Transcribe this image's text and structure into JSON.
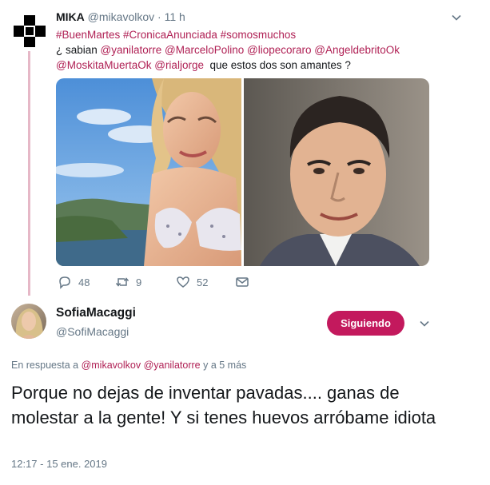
{
  "tweet": {
    "author_name": "MIKA",
    "author_handle": "@mikavolkov",
    "separator": "·",
    "time": "11 h",
    "line1": "#BuenMartes #CronicaAnunciada #somosmuchos",
    "line2_prefix": "¿ sabian",
    "line2_mentions": "@yanilatorre @MarceloPolino @liopecoraro @AngeldebritoOk",
    "line3_mentions": "@MoskitaMuertaOk @rialjorge",
    "line3_suffix": "que estos dos son amantes ?",
    "replies": "48",
    "retweets": "9",
    "likes": "52"
  },
  "reply": {
    "author_name": "SofiaMacaggi",
    "author_handle": "@SofiMacaggi",
    "follow_label": "Siguiendo",
    "replying_prefix": "En respuesta a",
    "replying_mentions": "@mikavolkov @yanilatorre",
    "replying_suffix": "y a 5 más",
    "text": "Porque no dejas de inventar pavadas.... ganas de molestar a la gente! Y si tenes huevos arróbame idiota",
    "timestamp": "12:17 - 15 ene. 2019"
  },
  "icons": {
    "reply": "reply-icon",
    "retweet": "retweet-icon",
    "like": "heart-icon",
    "dm": "envelope-icon",
    "more": "chevron-down-icon"
  },
  "colors": {
    "accent": "#c3195d",
    "link": "#b02155",
    "muted": "#657786",
    "thread_line": "#e6b8c7"
  }
}
